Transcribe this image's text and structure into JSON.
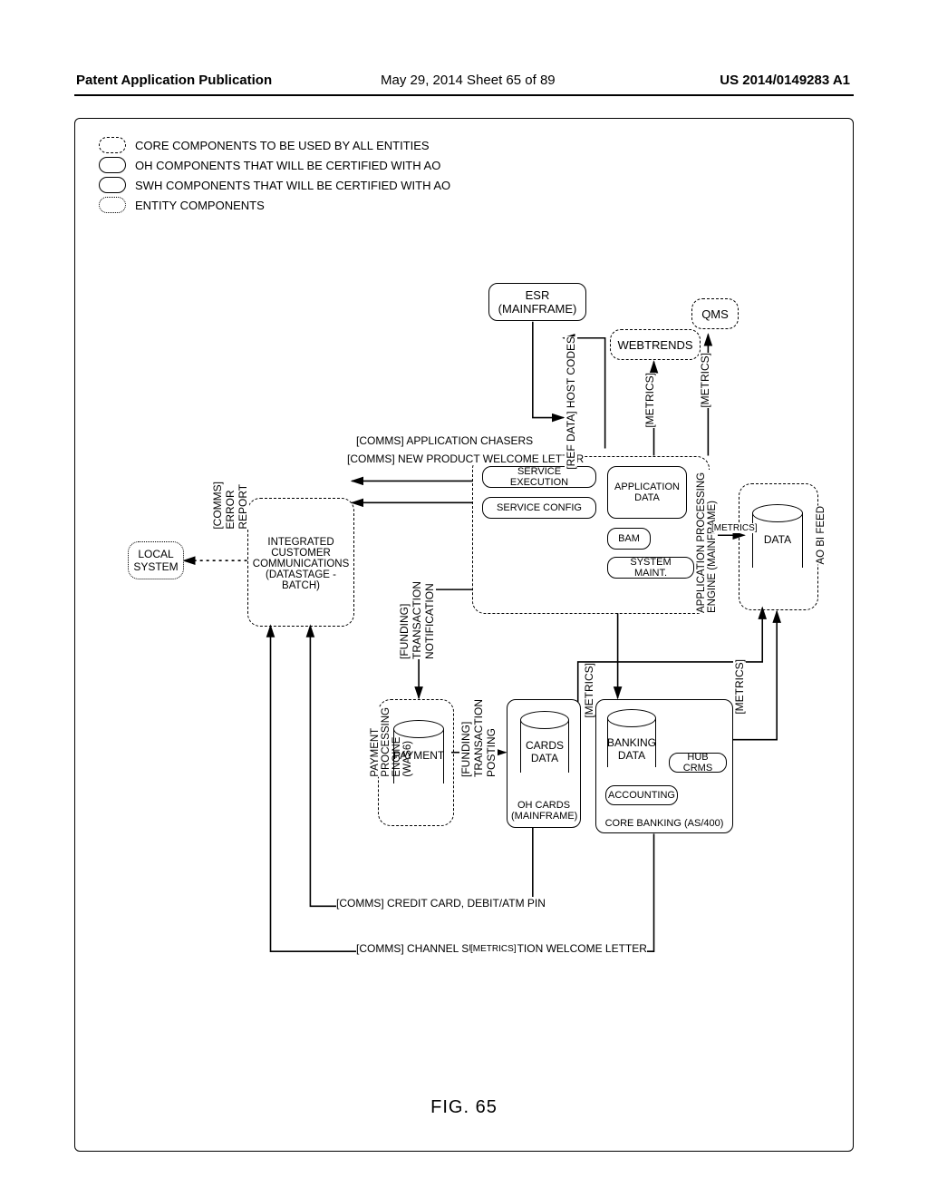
{
  "header": {
    "pub": "Patent Application Publication",
    "date_sheet": "May 29, 2014  Sheet 65 of 89",
    "pubno": "US 2014/0149283 A1"
  },
  "figure_caption": "FIG. 65",
  "legend": {
    "core": "CORE COMPONENTS TO BE USED BY ALL ENTITIES",
    "oh": "OH COMPONENTS THAT WILL BE CERTIFIED WITH AO",
    "swh": "SWH COMPONENTS THAT WILL BE CERTIFIED WITH AO",
    "ent": "ENTITY COMPONENTS"
  },
  "nodes": {
    "esr": "ESR\n(MAINFRAME)",
    "webtrends": "WEBTRENDS",
    "qms": "QMS",
    "localsys": "LOCAL\nSYSTEM",
    "icc": "INTEGRATED\nCUSTOMER\nCOMMUNICATIONS\n(DATASTAGE - BATCH)",
    "svc_exec": "SERVICE EXECUTION",
    "svc_config": "SERVICE CONFIG",
    "app_data": "APPLICATION\nDATA",
    "bam": "BAM",
    "sys_maint": "SYSTEM MAINT.",
    "ape_group": "APPLICATION PROCESSING ENGINE (MAINFRAME)",
    "bi_group": "AO BI FEED",
    "bi_data": "DATA",
    "pmt_group": "PAYMENT\nPROCESSING\nENGINE\n(WAS6)",
    "pmt_data": "PAYMENT",
    "ohcards": "OH CARDS\n(MAINFRAME)",
    "cards_data": "CARDS\nDATA",
    "core_bank": "CORE BANKING (AS/400)",
    "bank_data": "BANKING\nDATA",
    "accounting": "ACCOUNTING",
    "hubcrms": "HUB CRMS"
  },
  "annotations": {
    "comms_error": "[COMMS]\nERROR\nREPORT",
    "comms_chasers": "[COMMS] APPLICATION CHASERS",
    "comms_welcome": "[COMMS] NEW PRODUCT WELCOME LETTER",
    "refdata": "[REF DATA] HOST CODES",
    "metrics": "[METRICS]",
    "funding_notif": "[FUNDING]\nTRANSACTION\nNOTIFICATION",
    "funding_post": "[FUNDING]\nTRANSACTION\nPOSTING",
    "comms_card_pin": "[COMMS] CREDIT CARD, DEBIT/ATM PIN",
    "comms_sub_letter": "[COMMS] CHANNEL SUBSCRIPTION WELCOME LETTER"
  }
}
